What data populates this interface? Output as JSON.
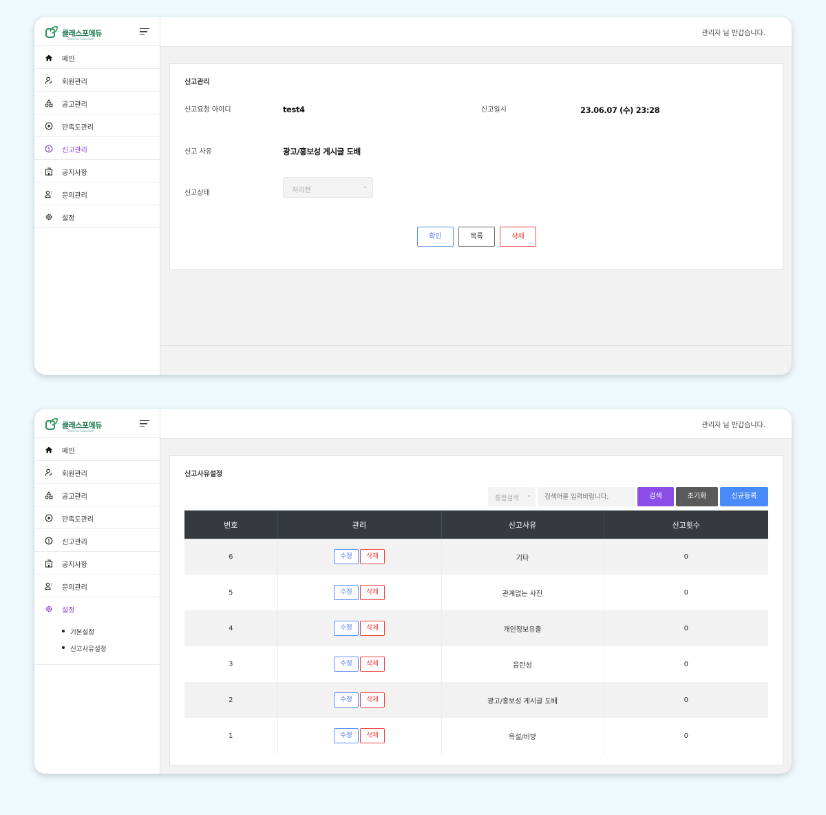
{
  "brand": {
    "name": "클래스포에듀",
    "tagline": "Class for Education",
    "color": "#1d7a4d"
  },
  "header": {
    "greeting": "관리자 님 반갑습니다."
  },
  "nav": [
    {
      "label": "메인",
      "icon": "home-icon"
    },
    {
      "label": "회원관리",
      "icon": "user-edit-icon"
    },
    {
      "label": "공고관리",
      "icon": "shapes-icon"
    },
    {
      "label": "만족도관리",
      "icon": "target-icon"
    },
    {
      "label": "신고관리",
      "icon": "alert-circle-icon"
    },
    {
      "label": "공지사항",
      "icon": "building-icon"
    },
    {
      "label": "문의관리",
      "icon": "user-question-icon"
    },
    {
      "label": "설정",
      "icon": "gear-icon"
    }
  ],
  "settings_sub": [
    "기본설정",
    "신고사유설정"
  ],
  "report_detail": {
    "title": "신고관리",
    "requester_label": "신고요청 아이디",
    "requester_value": "test4",
    "date_label": "신고일시",
    "date_value": "23.06.07 (수) 23:28",
    "reason_label": "신고 사유",
    "reason_value": "광고/홍보성 게시글 도배",
    "status_label": "신고상태",
    "status_value": "처리전",
    "buttons": {
      "confirm": "확인",
      "list": "목록",
      "delete": "삭제"
    }
  },
  "reason_settings": {
    "title": "신고사유설정",
    "search_type": "통합검색",
    "search_placeholder": "검색어를 입력바랍니다.",
    "buttons": {
      "search": "검색",
      "reset": "초기화",
      "new": "신규등록"
    },
    "columns": [
      "번호",
      "관리",
      "신고사유",
      "신고횟수"
    ],
    "row_buttons": {
      "edit": "수정",
      "delete": "삭제"
    },
    "rows": [
      {
        "no": "6",
        "reason": "기타",
        "count": "0"
      },
      {
        "no": "5",
        "reason": "관계없는 사진",
        "count": "0"
      },
      {
        "no": "4",
        "reason": "개인정보유출",
        "count": "0"
      },
      {
        "no": "3",
        "reason": "음란성",
        "count": "0"
      },
      {
        "no": "2",
        "reason": "광고/홍보성 게시글 도배",
        "count": "0"
      },
      {
        "no": "1",
        "reason": "욕설/비방",
        "count": "0"
      }
    ]
  },
  "colors": {
    "accent": "#8a3bd6",
    "primary": "#4a8af7",
    "danger": "#e33333",
    "table_header": "#343a40"
  }
}
